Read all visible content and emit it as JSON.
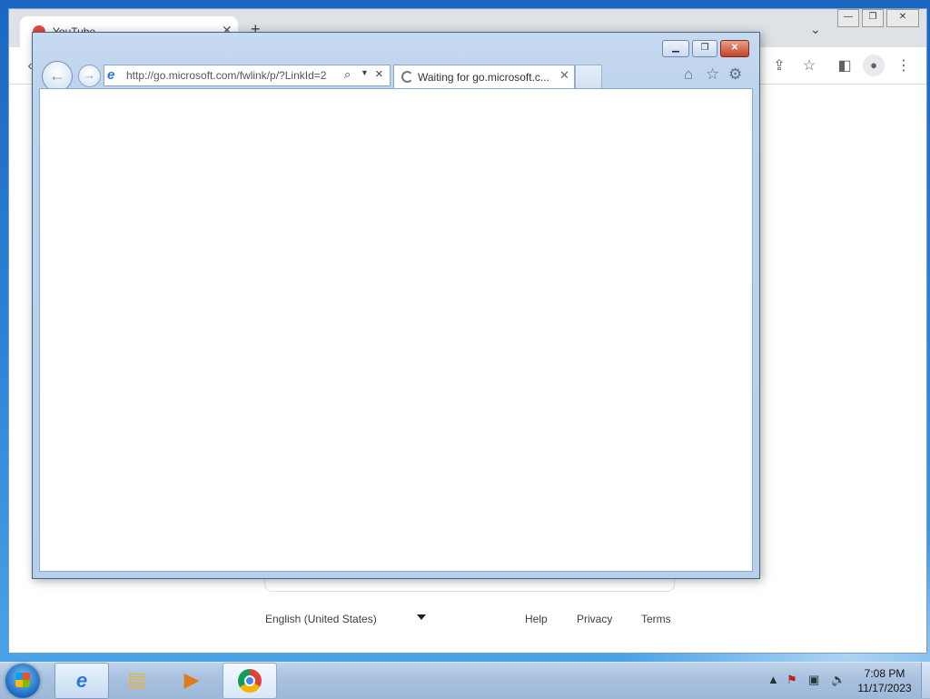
{
  "chrome": {
    "tab_title": "YouTube",
    "tab_close": "✕",
    "new_tab": "+",
    "tab_list": "⌄",
    "footer": {
      "language": "English (United States)",
      "links": [
        "Help",
        "Privacy",
        "Terms"
      ]
    }
  },
  "ie": {
    "address_url": "http://go.microsoft.com/fwlink/p/?LinkId=2",
    "tab_title": "Waiting for go.microsoft.c...",
    "tab_close": "✕"
  },
  "taskbar": {
    "apps": [
      {
        "name": "Internet Explorer",
        "icon": "ie-icon"
      },
      {
        "name": "Windows Explorer",
        "icon": "folder-icon"
      },
      {
        "name": "Windows Media Player",
        "icon": "media-player-icon"
      },
      {
        "name": "Google Chrome",
        "icon": "chrome-icon"
      }
    ],
    "time": "7:08 PM",
    "date": "11/17/2023"
  }
}
